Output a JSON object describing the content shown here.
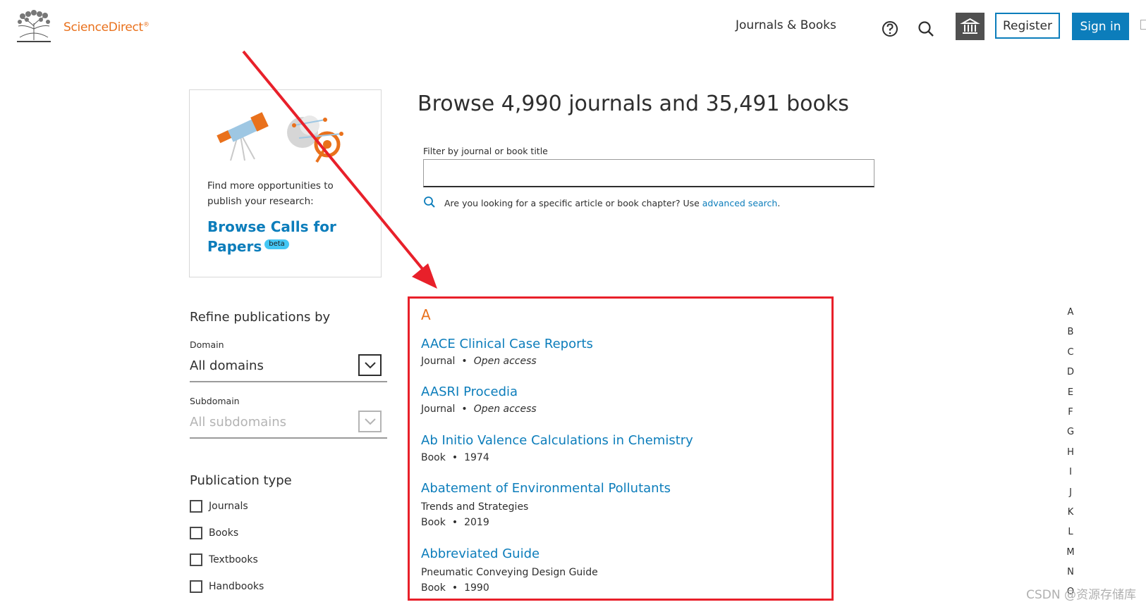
{
  "header": {
    "brand": "ScienceDirect",
    "brand_mark": "®",
    "nav_journals_books": "Journals & Books",
    "register_label": "Register",
    "signin_label": "Sign in"
  },
  "promo": {
    "description": "Find more opportunities to publish your research:",
    "link_label": "Browse Calls for Papers",
    "badge": "beta"
  },
  "main": {
    "headline": "Browse 4,990 journals and 35,491 books",
    "filter_label": "Filter by journal or book title",
    "filter_value": "",
    "hint_prefix": "Are you looking for a specific article or book chapter? Use ",
    "hint_link": "advanced search",
    "hint_suffix": "."
  },
  "refine": {
    "title": "Refine publications by",
    "domain_label": "Domain",
    "domain_value": "All domains",
    "subdomain_label": "Subdomain",
    "subdomain_value": "All subdomains",
    "pub_type_title": "Publication type",
    "pub_types": [
      "Journals",
      "Books",
      "Textbooks",
      "Handbooks"
    ]
  },
  "results": {
    "letter": "A",
    "items": [
      {
        "title": "AACE Clinical Case Reports",
        "subtitle": "",
        "type": "Journal",
        "extra": "Open access"
      },
      {
        "title": "AASRI Procedia",
        "subtitle": "",
        "type": "Journal",
        "extra": "Open access"
      },
      {
        "title": "Ab Initio Valence Calculations in Chemistry",
        "subtitle": "",
        "type": "Book",
        "extra": "1974"
      },
      {
        "title": "Abatement of Environmental Pollutants",
        "subtitle": "Trends and Strategies",
        "type": "Book",
        "extra": "2019"
      },
      {
        "title": "Abbreviated Guide",
        "subtitle": "Pneumatic Conveying Design Guide",
        "type": "Book",
        "extra": "1990"
      }
    ]
  },
  "az_index": [
    "A",
    "B",
    "C",
    "D",
    "E",
    "F",
    "G",
    "H",
    "I",
    "J",
    "K",
    "L",
    "M",
    "N",
    "O"
  ],
  "watermark": "CSDN @资源存储库",
  "colors": {
    "brand_orange": "#e9711c",
    "link_blue": "#0c7dbb",
    "annotation_red": "#e8202a"
  }
}
